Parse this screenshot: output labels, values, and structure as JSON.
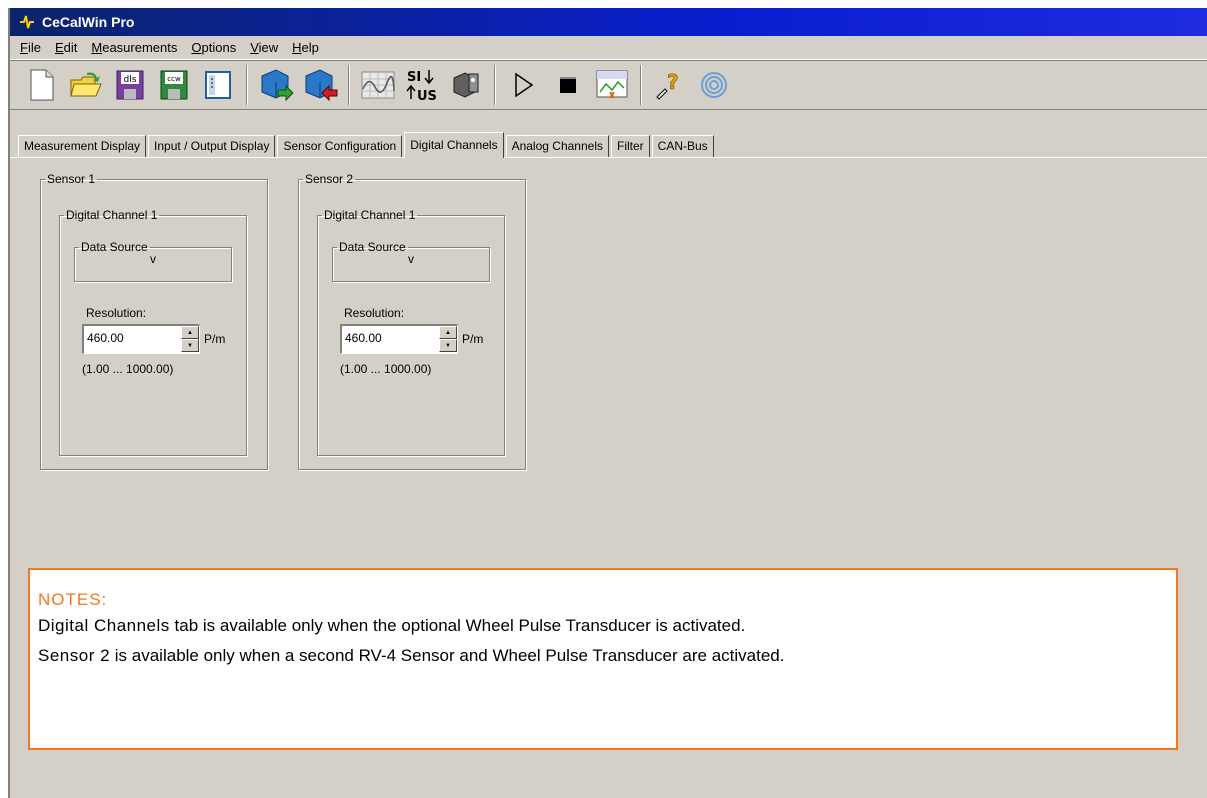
{
  "window": {
    "title": "CeCalWin Pro"
  },
  "menu": [
    {
      "label": "File",
      "u": "F",
      "rest": "ile"
    },
    {
      "label": "Edit",
      "u": "E",
      "rest": "dit"
    },
    {
      "label": "Measurements",
      "u": "M",
      "rest": "easurements"
    },
    {
      "label": "Options",
      "u": "O",
      "rest": "ptions"
    },
    {
      "label": "View",
      "u": "V",
      "rest": "iew"
    },
    {
      "label": "Help",
      "u": "H",
      "rest": "elp"
    }
  ],
  "toolbar": {
    "buttons": [
      "new-file-icon",
      "open-folder-icon",
      "save-dls-icon",
      "save-ccw-icon",
      "layout-icon",
      "upload-icon",
      "download-icon",
      "graph-icon",
      "si-us-units-icon",
      "sensor-icon",
      "play-icon",
      "stop-icon",
      "chart-window-icon",
      "help-icon",
      "about-icon"
    ],
    "dls_label": "dls",
    "ccw_label": "ccw",
    "si_label": "SI",
    "us_label": "US"
  },
  "tabs": [
    "Measurement Display",
    "Input / Output Display",
    "Sensor Configuration",
    "Digital Channels",
    "Analog Channels",
    "Filter",
    "CAN-Bus"
  ],
  "active_tab": "Digital Channels",
  "sensors": [
    {
      "legend": "Sensor 1",
      "channel_legend": "Digital Channel 1",
      "data_source_legend": "Data Source",
      "data_source_value": "v",
      "resolution_label": "Resolution:",
      "resolution_value": "460.00",
      "unit": "P/m",
      "range": "(1.00 ... 1000.00)"
    },
    {
      "legend": "Sensor 2",
      "channel_legend": "Digital Channel 1",
      "data_source_legend": "Data Source",
      "data_source_value": "v",
      "resolution_label": "Resolution:",
      "resolution_value": "460.00",
      "unit": "P/m",
      "range": "(1.00 ... 1000.00)"
    }
  ],
  "notes": {
    "title": "NOTES:",
    "line1_kw": "Digital Channels",
    "line1_text": " tab is available only when the optional Wheel Pulse Transducer is activated.",
    "line2_kw": "Sensor 2",
    "line2_text": " is available only when a second RV-4 Sensor and Wheel Pulse Transducer are activated."
  },
  "colors": {
    "accent_orange": "#f07820",
    "titlebar_blue": "#0a246a",
    "window_gray": "#d4d0c8"
  }
}
